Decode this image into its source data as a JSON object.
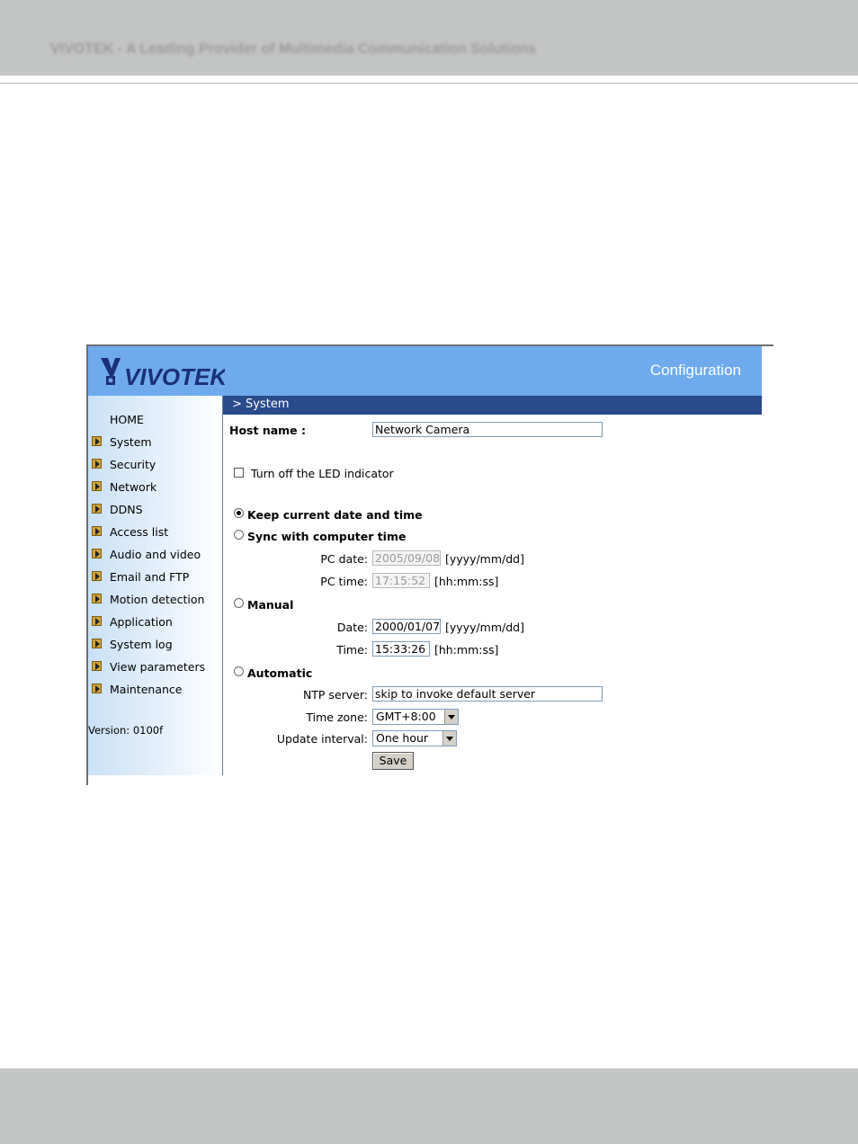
{
  "page": {
    "header_tagline": "VIVOTEK - A Leading Provider of Multimedia Communication Solutions"
  },
  "app": {
    "logo_text": "VIVOTEK",
    "title": "Configuration"
  },
  "sidebar": {
    "items": [
      {
        "label": "HOME"
      },
      {
        "label": "System"
      },
      {
        "label": "Security"
      },
      {
        "label": "Network"
      },
      {
        "label": "DDNS"
      },
      {
        "label": "Access list"
      },
      {
        "label": "Audio and video"
      },
      {
        "label": "Email and FTP"
      },
      {
        "label": "Motion detection"
      },
      {
        "label": "Application"
      },
      {
        "label": "System log"
      },
      {
        "label": "View parameters"
      },
      {
        "label": "Maintenance"
      }
    ],
    "version": "Version: 0100f"
  },
  "section": {
    "title": "> System"
  },
  "form": {
    "host_name_label": "Host name :",
    "host_name_value": "Network Camera",
    "led_label": "Turn off the LED indicator",
    "led_checked": false,
    "keep_label": "Keep current date and time",
    "sync_label": "Sync with computer time",
    "pc_date_label": "PC date:",
    "pc_date_value": "2005/09/08",
    "date_format": "[yyyy/mm/dd]",
    "pc_time_label": "PC time:",
    "pc_time_value": "17:15:52",
    "time_format": "[hh:mm:ss]",
    "manual_label": "Manual",
    "date_label": "Date:",
    "date_value": "2000/01/07",
    "time_label": "Time:",
    "time_value": "15:33:26",
    "automatic_label": "Automatic",
    "ntp_label": "NTP server:",
    "ntp_value": "skip to invoke default server",
    "timezone_label": "Time zone:",
    "timezone_value": "GMT+8:00",
    "update_label": "Update interval:",
    "update_value": "One hour",
    "save_label": "Save",
    "selected_mode": "keep"
  }
}
